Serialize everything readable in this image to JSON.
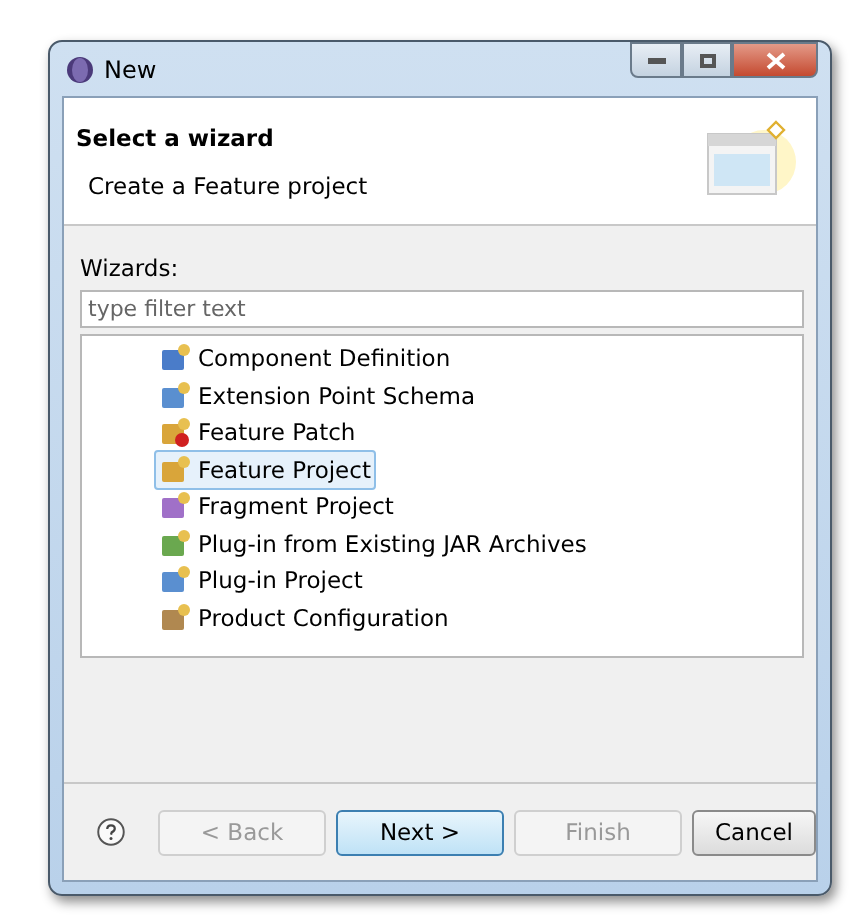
{
  "window": {
    "title": "New"
  },
  "header": {
    "title": "Select a wizard",
    "description": "Create a Feature project"
  },
  "wizards_label": "Wizards:",
  "filter": {
    "placeholder": "type filter text"
  },
  "tree": [
    {
      "label": "Component Definition",
      "kind": "component",
      "selected": false
    },
    {
      "label": "Extension Point Schema",
      "kind": "schema",
      "selected": false
    },
    {
      "label": "Feature Patch",
      "kind": "patch",
      "selected": false
    },
    {
      "label": "Feature Project",
      "kind": "feature",
      "selected": true
    },
    {
      "label": "Fragment Project",
      "kind": "fragment",
      "selected": false
    },
    {
      "label": "Plug-in from Existing JAR Archives",
      "kind": "jar",
      "selected": false
    },
    {
      "label": "Plug-in Project",
      "kind": "plugin",
      "selected": false
    },
    {
      "label": "Product Configuration",
      "kind": "product",
      "selected": false
    }
  ],
  "buttons": [
    {
      "label": "< Back",
      "disabled": true,
      "default": false
    },
    {
      "label": "Next >",
      "disabled": false,
      "default": true
    },
    {
      "label": "Finish",
      "disabled": true,
      "default": false
    },
    {
      "label": "Cancel",
      "disabled": false,
      "default": false
    }
  ]
}
